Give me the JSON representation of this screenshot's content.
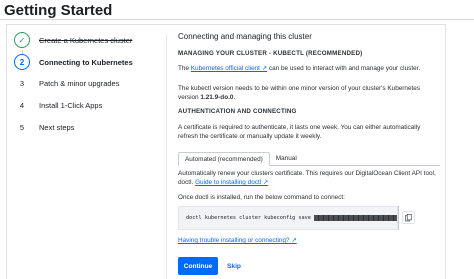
{
  "page": {
    "title": "Getting Started"
  },
  "steps": [
    {
      "marker": "✓",
      "label": "Create a Kubernetes cluster",
      "state": "done"
    },
    {
      "marker": "2",
      "label": "Connecting to Kubernetes",
      "state": "active"
    },
    {
      "marker": "3",
      "label": "Patch & minor upgrades",
      "state": "pending"
    },
    {
      "marker": "4",
      "label": "Install 1-Click Apps",
      "state": "pending"
    },
    {
      "marker": "5",
      "label": "Next steps",
      "state": "pending"
    }
  ],
  "main": {
    "heading": "Connecting and managing this cluster",
    "kubectl": {
      "heading": "MANAGING YOUR CLUSTER - KUBECTL (RECOMMENDED)",
      "p1_pre": "The ",
      "p1_link": "Kubernetes official client ↗",
      "p1_post": " can be used to interact with and manage your cluster.",
      "p2_pre": "The kubectl version needs to be within one minor version of your cluster's Kubernetes version ",
      "p2_version": "1.21.9-do.0",
      "p2_post": "."
    },
    "auth": {
      "heading": "AUTHENTICATION AND CONNECTING",
      "text": "A certificate is required to authenticate, it lasts one week. You can either automatically refresh the certificate or manually update it weekly."
    },
    "tabs": [
      {
        "label": "Automated (recommended)",
        "active": true
      },
      {
        "label": "Manual",
        "active": false
      }
    ],
    "automated": {
      "text_pre": "Automatically renew your clusters certificate. This requires our DigitalOcean Client API tool, doctl. ",
      "guide_link": "Guide to installing doctl ↗",
      "run_text": "Once doctl is installed, run the below command to connect:",
      "command": "doctl kubernetes cluster kubeconfig save"
    },
    "trouble_link": "Having trouble installing or connecting? ↗"
  },
  "actions": {
    "continue_label": "Continue",
    "skip_label": "Skip"
  },
  "colors": {
    "accent": "#0069ff",
    "done": "#2c9a5a"
  }
}
